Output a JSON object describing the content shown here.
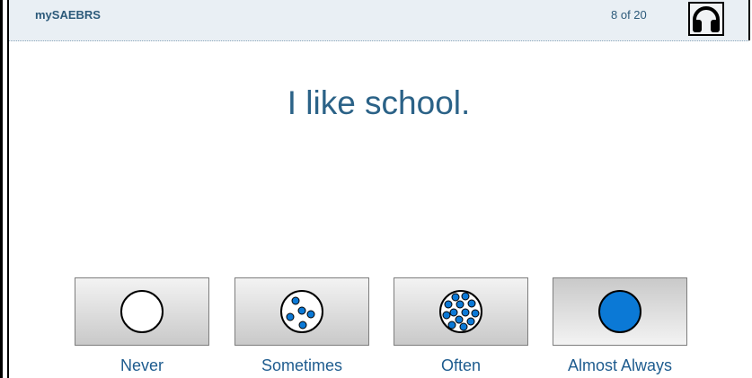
{
  "header": {
    "app_title": "mySAEBRS",
    "progress": "8 of 20",
    "audio_icon": "headphones-icon"
  },
  "question": {
    "text": "I like school."
  },
  "answers": [
    {
      "label": "Never",
      "icon": "empty-circle-icon"
    },
    {
      "label": "Sometimes",
      "icon": "few-dots-circle-icon"
    },
    {
      "label": "Often",
      "icon": "many-dots-circle-icon"
    },
    {
      "label": "Almost Always",
      "icon": "filled-circle-icon"
    }
  ],
  "colors": {
    "accent_blue": "#0b79d6",
    "text_blue": "#2b6287",
    "header_bg": "#e9eff4"
  }
}
